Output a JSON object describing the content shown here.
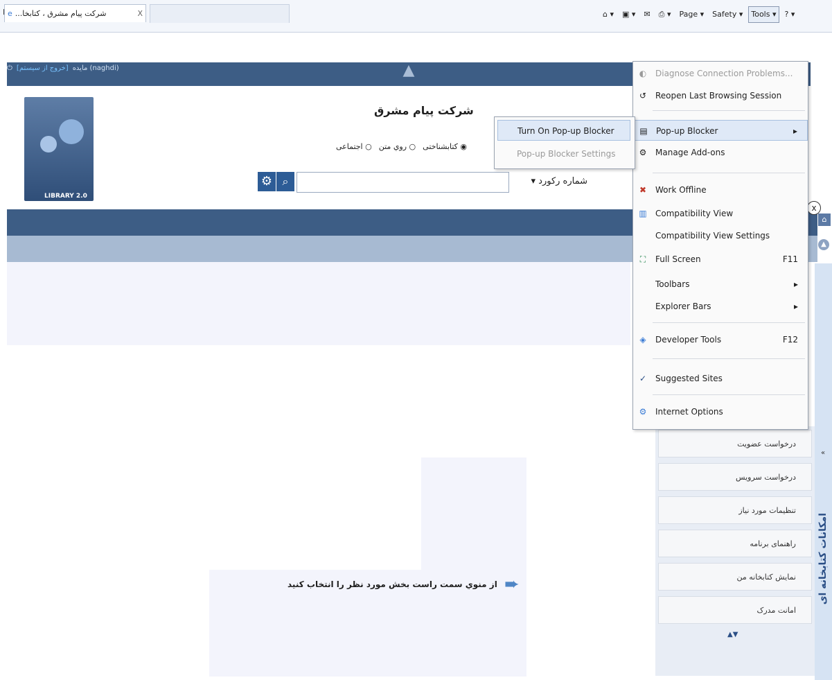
{
  "browser": {
    "tab_title": "شرکت پیام مشرق ، کتابخا...",
    "tab_close": "X",
    "cmd": {
      "page": "Page",
      "safety": "Safety",
      "tools": "Tools"
    }
  },
  "page": {
    "user_label": "مایده (naghdi)",
    "logout_link": "[خروج از سیستم]",
    "logo_text": "LIBRARY 2.0",
    "title": "شرکت پیام مشرق",
    "radios": [
      "کتابشناختی",
      "روي متن",
      "اجتماعی"
    ],
    "search_field": "شماره رکورد",
    "hint": "از منوي سمت راست بخش مورد نظر را انتخاب کنید"
  },
  "sidebar": {
    "vertical_title": "امکانات کتابخانه ای",
    "items": [
      "درخواست عضویت",
      "درخواست سرویس",
      "تنظیمات مورد نیاز",
      "راهنمای برنامه",
      "نمایش کتابخانه من",
      "امانت مدرک"
    ]
  },
  "tools_menu": {
    "items": [
      {
        "label": "Diagnose Connection Problems...",
        "shortcut": ""
      },
      {
        "label": "Reopen Last Browsing Session",
        "shortcut": ""
      },
      {
        "label": "Pop-up Blocker",
        "shortcut": ""
      },
      {
        "label": "Manage Add-ons",
        "shortcut": ""
      },
      {
        "label": "Work Offline",
        "shortcut": ""
      },
      {
        "label": "Compatibility View",
        "shortcut": ""
      },
      {
        "label": "Compatibility View Settings",
        "shortcut": ""
      },
      {
        "label": "Full Screen",
        "shortcut": "F11"
      },
      {
        "label": "Toolbars",
        "shortcut": ""
      },
      {
        "label": "Explorer Bars",
        "shortcut": ""
      },
      {
        "label": "Developer Tools",
        "shortcut": "F12"
      },
      {
        "label": "Suggested Sites",
        "shortcut": ""
      },
      {
        "label": "Internet Options",
        "shortcut": ""
      }
    ]
  },
  "popup_submenu": {
    "turn_on": "Turn On Pop-up Blocker",
    "settings": "Pop-up Blocker Settings"
  }
}
